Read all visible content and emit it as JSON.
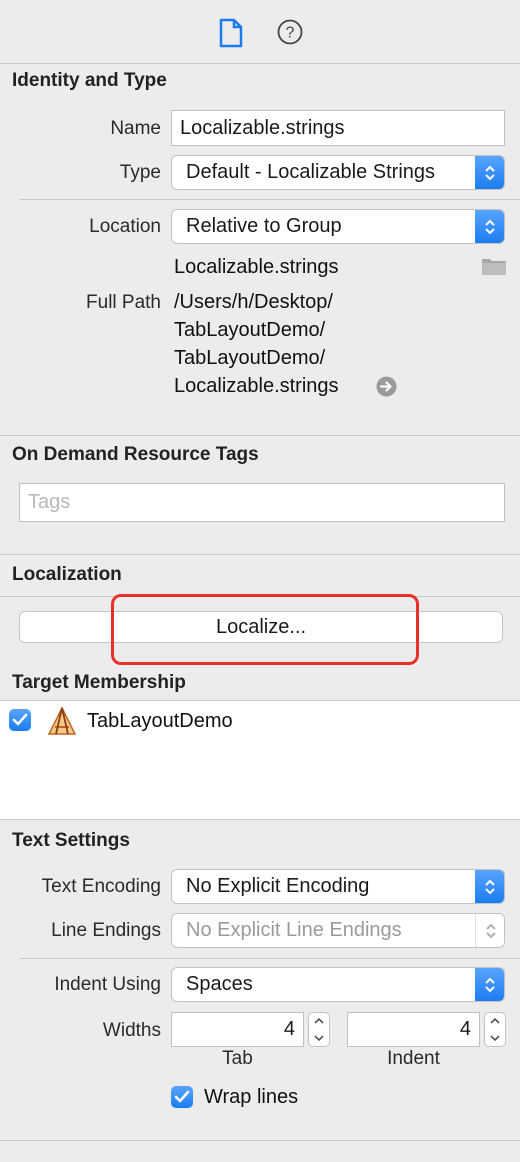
{
  "toolbar": {
    "file_icon": "file-inspector-icon",
    "help_icon": "help-icon"
  },
  "identity": {
    "title": "Identity and Type",
    "name_label": "Name",
    "name_value": "Localizable.strings",
    "type_label": "Type",
    "type_value": "Default - Localizable Strings",
    "location_label": "Location",
    "location_value": "Relative to Group",
    "location_file": "Localizable.strings",
    "full_path_label": "Full Path",
    "full_path_lines": [
      "/Users/h/Desktop/",
      "TabLayoutDemo/",
      "TabLayoutDemo/",
      "Localizable.strings"
    ]
  },
  "odr": {
    "title": "On Demand Resource Tags",
    "tags_placeholder": "Tags"
  },
  "localization": {
    "title": "Localization",
    "button_label": "Localize...",
    "highlight_color": "#e8312b"
  },
  "target": {
    "title": "Target Membership",
    "items": [
      {
        "label": "TabLayoutDemo",
        "checked": true
      }
    ]
  },
  "text_settings": {
    "title": "Text Settings",
    "encoding_label": "Text Encoding",
    "encoding_value": "No Explicit Encoding",
    "line_endings_label": "Line Endings",
    "line_endings_value": "No Explicit Line Endings",
    "indent_using_label": "Indent Using",
    "indent_using_value": "Spaces",
    "widths_label": "Widths",
    "tab_value": "4",
    "tab_caption": "Tab",
    "indent_value": "4",
    "indent_caption": "Indent",
    "wrap_label": "Wrap lines"
  },
  "colors": {
    "accent": "#1a7cf0",
    "panel": "#ececec"
  }
}
